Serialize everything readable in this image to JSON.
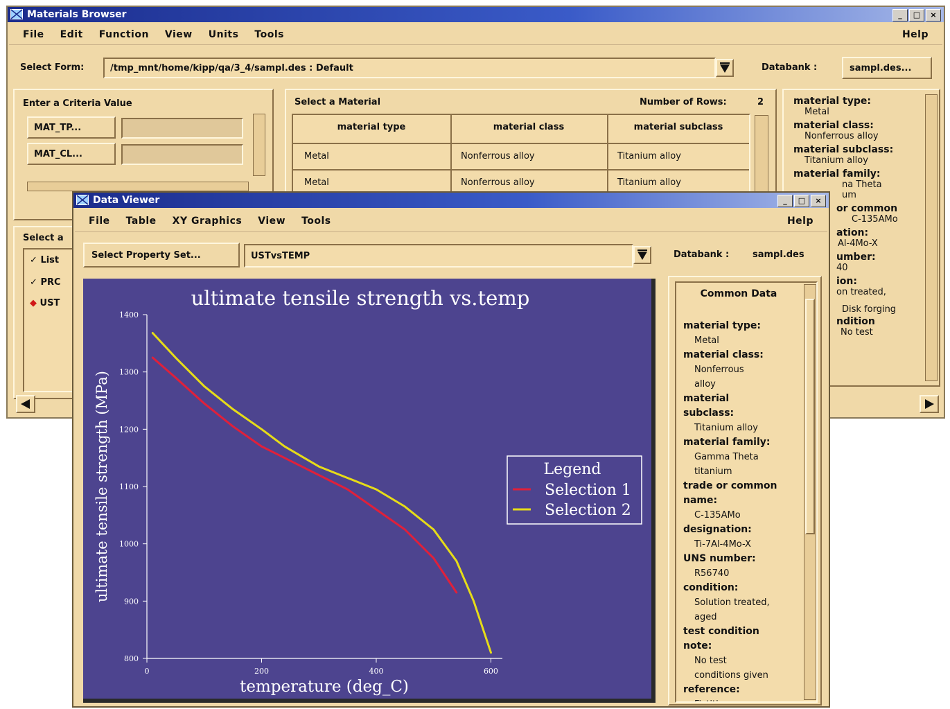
{
  "materials_browser": {
    "title": "Materials Browser",
    "window_controls": [
      "_",
      "□",
      "×"
    ],
    "menu": [
      "File",
      "Edit",
      "Function",
      "View",
      "Units",
      "Tools"
    ],
    "help_label": "Help",
    "select_form_label": "Select Form:",
    "select_form_value": "/tmp_mnt/home/kipp/qa/3_4/sampl.des : Default",
    "databank_label": "Databank :",
    "databank_button": "sampl.des...",
    "criteria": {
      "title": "Enter a Criteria Value",
      "rows": [
        {
          "button": "MAT_TP...",
          "value": ""
        },
        {
          "button": "MAT_CL...",
          "value": ""
        }
      ]
    },
    "select_panel": {
      "title_fragment": "Select a",
      "items": [
        {
          "icon": "check-icon",
          "label": "List"
        },
        {
          "icon": "check-icon",
          "label": "PRC"
        },
        {
          "icon": "diamond-icon",
          "label": "UST"
        }
      ]
    },
    "material_table": {
      "title": "Select a Material",
      "rows_label": "Number of Rows:",
      "rows_count": "2",
      "headers": [
        "material type",
        "material class",
        "material subclass"
      ],
      "rows": [
        [
          "Metal",
          "Nonferrous alloy",
          "Titanium alloy"
        ],
        [
          "Metal",
          "Nonferrous alloy",
          "Titanium alloy"
        ]
      ]
    },
    "right_panel": [
      {
        "label": "material type:",
        "value": "Metal"
      },
      {
        "label": "material class:",
        "value": "Nonferrous alloy"
      },
      {
        "label": "material subclass:",
        "value": "Titanium alloy"
      },
      {
        "label": "material family:",
        "value": "na Theta"
      },
      {
        "label": "",
        "value": "um"
      },
      {
        "label": "or common",
        "value": "C-135AMo"
      },
      {
        "label": "ation:",
        "value": "Al-4Mo-X"
      },
      {
        "label": "umber:",
        "value": "40"
      },
      {
        "label": "ion:",
        "value": "on treated,"
      },
      {
        "label": "",
        "value": "Disk forging"
      },
      {
        "label": "ndition",
        "value": "No test"
      }
    ]
  },
  "data_viewer": {
    "title": "Data Viewer",
    "menu": [
      "File",
      "Table",
      "XY Graphics",
      "View",
      "Tools"
    ],
    "help_label": "Help",
    "property_button": "Select Property Set...",
    "property_value": "USTvsTEMP",
    "databank_label": "Databank :",
    "databank_value": "sampl.des",
    "common_data_title": "Common Data",
    "common_data": [
      {
        "label": "material type:",
        "value": "Metal"
      },
      {
        "label": "material class:",
        "value": "Nonferrous alloy"
      },
      {
        "label": "material subclass:",
        "value": "Titanium alloy"
      },
      {
        "label": "material family:",
        "value": "Gamma Theta titanium"
      },
      {
        "label": "trade or common name:",
        "value": "C-135AMo"
      },
      {
        "label": "designation:",
        "value": "Ti-7Al-4Mo-X"
      },
      {
        "label": "UNS number:",
        "value": "R56740"
      },
      {
        "label": "condition:",
        "value": "Solution treated, aged"
      },
      {
        "label": "test condition note:",
        "value": "No test conditions given"
      },
      {
        "label": "reference:",
        "value": "Fictitious"
      }
    ]
  },
  "colors": {
    "window_bg": "#f0d9a8",
    "plot_bg": "#4d448f",
    "selection_1": "#e0203a",
    "selection_2": "#e6dc18",
    "title_bar": "#1b2c8c"
  },
  "chart_data": {
    "type": "line",
    "title": "ultimate tensile strength vs.temp",
    "xlabel": "temperature (deg_C)",
    "ylabel": "ultimate tensile strength (MPa)",
    "xlim": [
      0,
      620
    ],
    "ylim": [
      800,
      1400
    ],
    "xticks": [
      0,
      200,
      400,
      600
    ],
    "yticks": [
      800,
      900,
      1000,
      1100,
      1200,
      1300,
      1400
    ],
    "grid": false,
    "legend_title": "Legend",
    "legend_position": "right",
    "series": [
      {
        "name": "Selection 1",
        "color": "#e0203a",
        "x": [
          10,
          50,
          100,
          150,
          200,
          250,
          300,
          350,
          400,
          450,
          500,
          540
        ],
        "y": [
          1325,
          1290,
          1245,
          1205,
          1170,
          1145,
          1120,
          1095,
          1060,
          1025,
          975,
          915
        ]
      },
      {
        "name": "Selection 2",
        "color": "#e6dc18",
        "x": [
          10,
          50,
          100,
          150,
          200,
          240,
          300,
          350,
          400,
          450,
          500,
          540,
          570,
          600
        ],
        "y": [
          1368,
          1325,
          1275,
          1235,
          1200,
          1170,
          1135,
          1115,
          1095,
          1065,
          1025,
          970,
          900,
          810
        ]
      }
    ]
  }
}
